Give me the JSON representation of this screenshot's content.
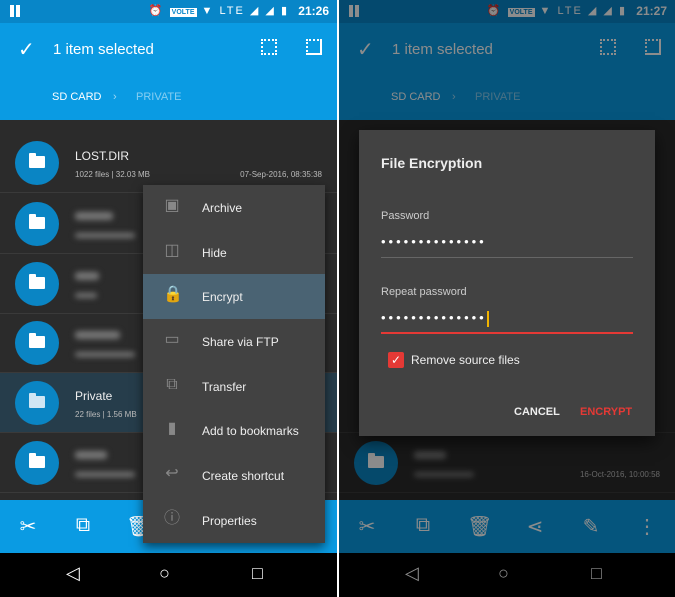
{
  "colors": {
    "primary": "#0a9be3",
    "status_bar": "#0886c8",
    "accent": "#e53935",
    "background": "#2b2b2b"
  },
  "left": {
    "status": {
      "time": "21:26",
      "network": "LTE",
      "volte": "VOLTE"
    },
    "appbar": {
      "title": "1 item selected",
      "breadcrumb": [
        "SD CARD",
        "PRIVATE"
      ]
    },
    "rows": [
      {
        "name": "LOST.DIR",
        "meta": "1022 files | 32.03 MB",
        "date": "07-Sep-2016, 08:35:38"
      },
      {
        "name": "Private",
        "meta": "22 files | 1.56 MB",
        "date": ""
      }
    ],
    "menu": [
      {
        "label": "Archive",
        "icon": "archive-icon"
      },
      {
        "label": "Hide",
        "icon": "hide-icon"
      },
      {
        "label": "Encrypt",
        "icon": "lock-icon",
        "highlighted": true
      },
      {
        "label": "Share via FTP",
        "icon": "devices-icon"
      },
      {
        "label": "Transfer",
        "icon": "transfer-icon"
      },
      {
        "label": "Add to bookmarks",
        "icon": "bookmark-icon"
      },
      {
        "label": "Create shortcut",
        "icon": "reply-icon"
      },
      {
        "label": "Properties",
        "icon": "info-icon"
      }
    ]
  },
  "right": {
    "status": {
      "time": "21:27",
      "network": "LTE",
      "volte": "VOLTE"
    },
    "appbar": {
      "title": "1 item selected",
      "breadcrumb": [
        "SD CARD",
        "PRIVATE"
      ]
    },
    "last_row_date": "16-Oct-2016, 10:00:58",
    "dialog": {
      "title": "File Encryption",
      "password_label": "Password",
      "password_value": "••••••••••••••",
      "repeat_label": "Repeat password",
      "repeat_value": "••••••••••••••",
      "checkbox_label": "Remove source files",
      "checkbox_checked": true,
      "cancel": "CANCEL",
      "encrypt": "ENCRYPT"
    }
  }
}
